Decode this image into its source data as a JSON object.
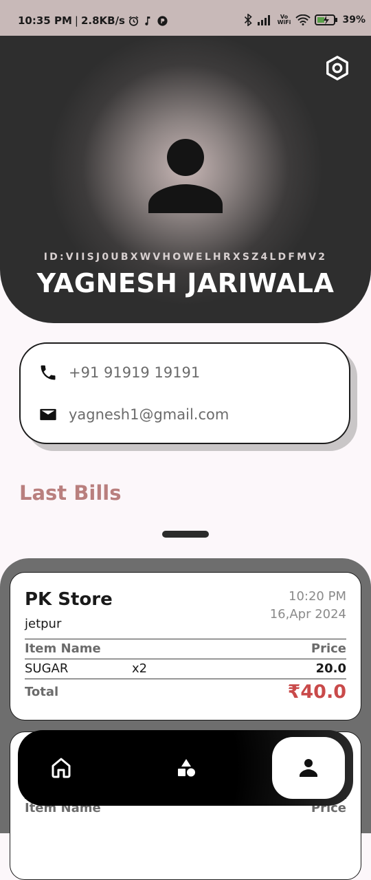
{
  "status_bar": {
    "time": "10:35 PM",
    "separator": "|",
    "speed": "2.8KB/s",
    "battery_percent": "39%",
    "icons": [
      "alarm-icon",
      "music-note-icon",
      "app-icon",
      "bluetooth-icon",
      "signal-icon",
      "vowifi-icon",
      "wifi-icon",
      "battery-charging-icon"
    ],
    "vowifi_label": "Vo WiFi"
  },
  "profile": {
    "user_id": "ID:VIISJ0UBXWVHOWELHRXSZ4LDFMV2",
    "name": "YAGNESH JARIWALA",
    "phone": "+91 91919 19191",
    "email": "yagnesh1@gmail.com"
  },
  "section": {
    "last_bills_title": "Last Bills"
  },
  "bills": [
    {
      "store": "PK Store",
      "city": "jetpur",
      "time": "10:20 PM",
      "date": "16,Apr 2024",
      "header_item": "Item Name",
      "header_price": "Price",
      "items": [
        {
          "name": "SUGAR",
          "qty": "x2",
          "price": "20.0"
        }
      ],
      "total_label": "Total",
      "total": "₹40.0"
    },
    {
      "header_item": "Item Name",
      "header_price": "Price"
    }
  ],
  "nav": {
    "items": [
      {
        "icon": "home-icon",
        "active": false
      },
      {
        "icon": "categories-icon",
        "active": false
      },
      {
        "icon": "profile-icon",
        "active": true
      }
    ]
  },
  "colors": {
    "accent": "#b97f7e",
    "total_red": "#c94a4a",
    "header_dark": "#2e2e2e",
    "status_bar": "#c8b9b8"
  }
}
